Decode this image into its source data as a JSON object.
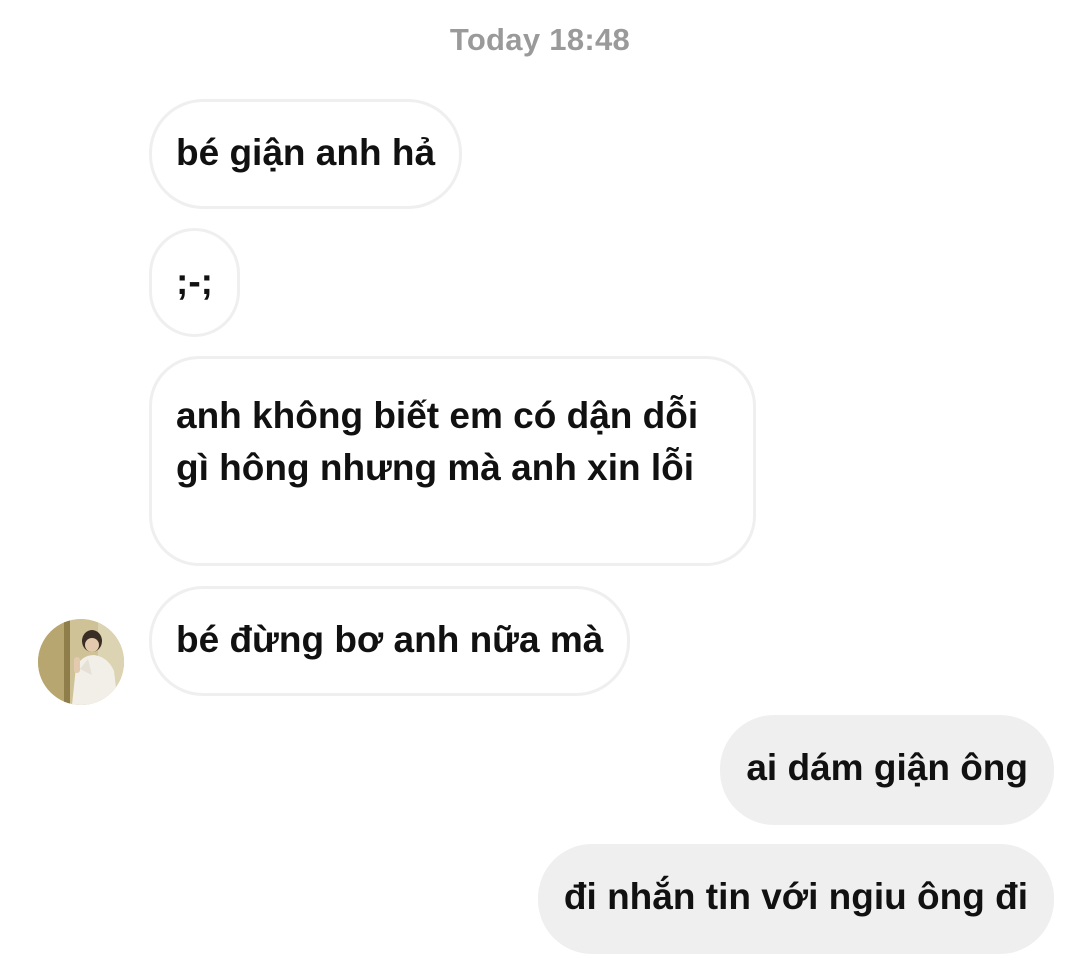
{
  "thread": {
    "timestamp": "Today 18:48",
    "messages": [
      {
        "direction": "incoming",
        "text": "bé giận anh hả"
      },
      {
        "direction": "incoming",
        "text": ";-;"
      },
      {
        "direction": "incoming",
        "text": "anh không biết em có dận dỗi gì hông nhưng mà anh xin lỗi"
      },
      {
        "direction": "incoming",
        "text": "bé đừng bơ anh nữa mà"
      },
      {
        "direction": "outgoing",
        "text": "ai dám giận ông"
      },
      {
        "direction": "outgoing",
        "text": "đi nhắn tin với ngiu ông đi"
      }
    ]
  },
  "colors": {
    "timestamp": "#9a9a9a",
    "incoming_border": "#efefef",
    "outgoing_background": "#efefef",
    "text": "#111111"
  }
}
